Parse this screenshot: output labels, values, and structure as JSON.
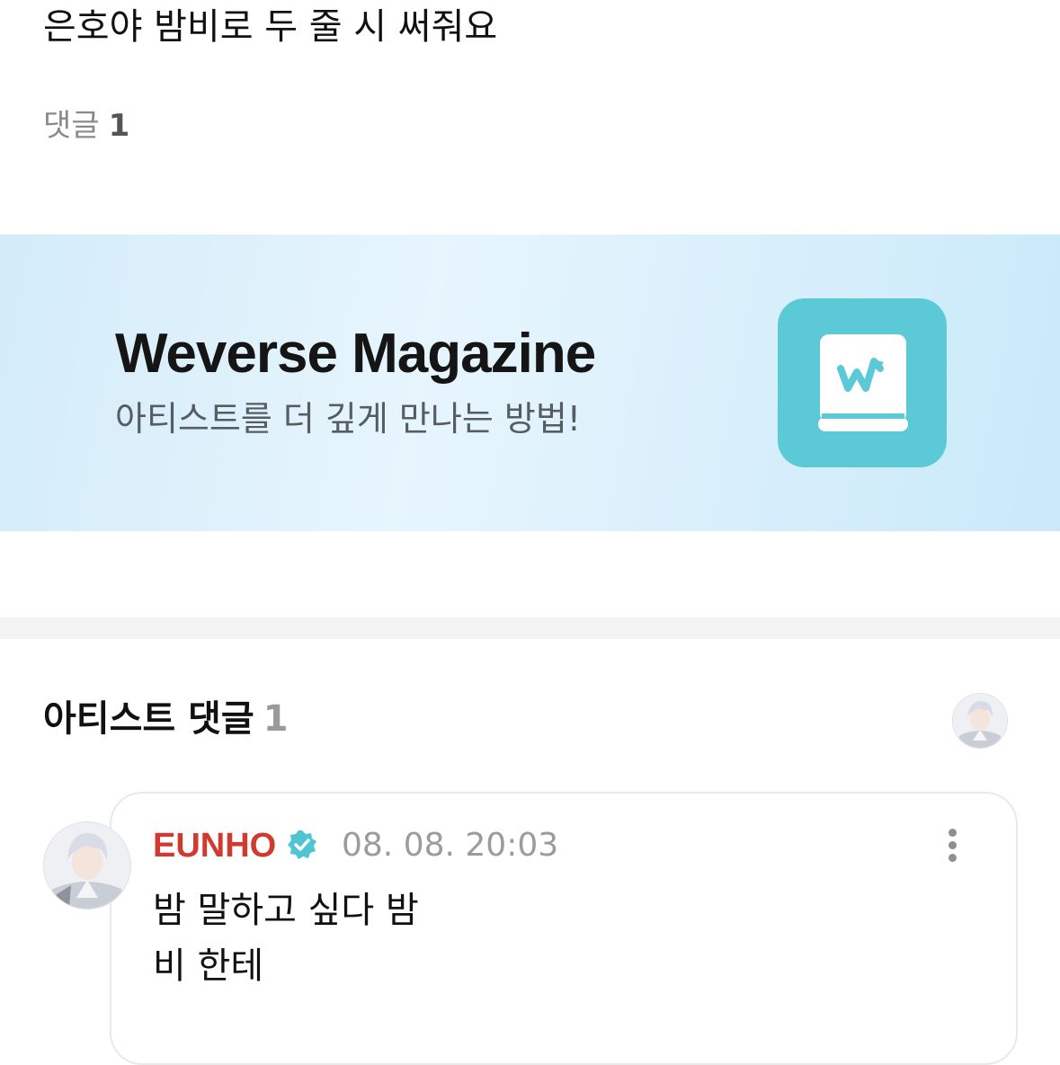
{
  "post": {
    "text": "은호야 밤비로 두 줄 시 써줘요",
    "comments_label": "댓글",
    "comments_count": "1"
  },
  "banner": {
    "title": "Weverse Magazine",
    "subtitle": "아티스트를 더 깊게 만나는 방법!",
    "icon": "weverse-magazine-app-icon",
    "icon_color": "#5ccad6"
  },
  "artist_comments": {
    "title": "아티스트 댓글",
    "count": "1",
    "avatar_icon": "artist-avatar"
  },
  "comment": {
    "author": "EUNHO",
    "author_color": "#d23a2f",
    "verified_icon": "verified-badge-icon",
    "time": "08. 08. 20:03",
    "lines": [
      "밤 말하고 싶다 밤",
      "비 한테"
    ],
    "more_icon": "more-vertical-icon"
  }
}
